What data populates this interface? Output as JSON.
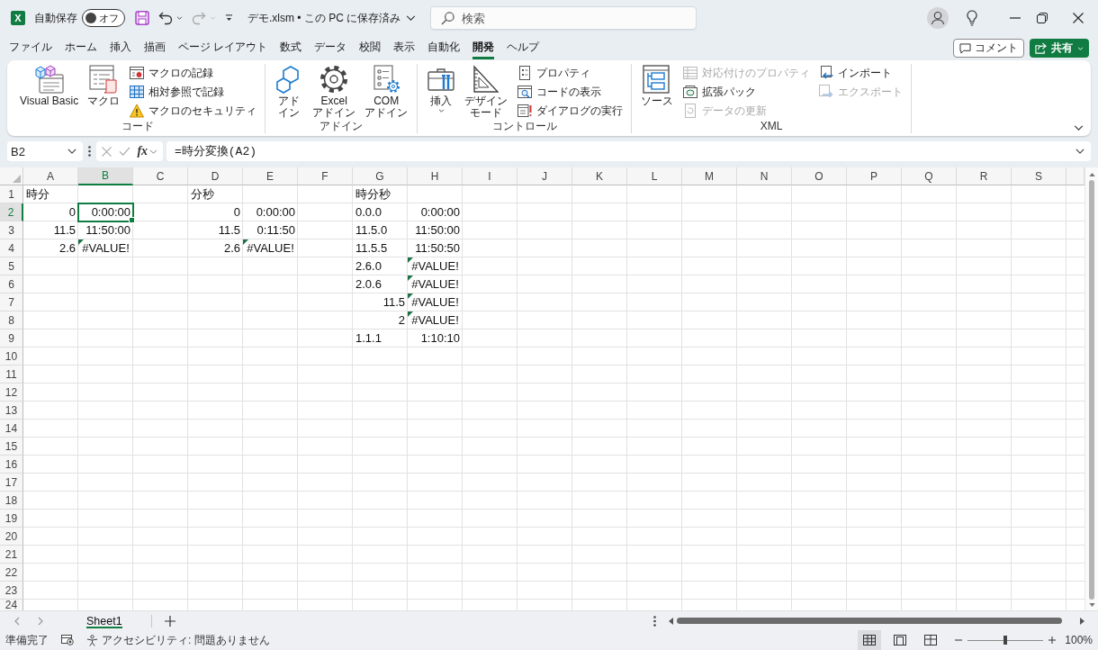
{
  "titlebar": {
    "logo": "X",
    "autosave": {
      "label": "自動保存",
      "state_text": "オフ",
      "on": false
    },
    "filename": "デモ.xlsm • この PC に保存済み",
    "search": {
      "placeholder": "検索"
    }
  },
  "tabs": [
    {
      "label": "ファイル",
      "selected": false
    },
    {
      "label": "ホーム",
      "selected": false
    },
    {
      "label": "挿入",
      "selected": false
    },
    {
      "label": "描画",
      "selected": false
    },
    {
      "label": "ページ レイアウト",
      "selected": false
    },
    {
      "label": "数式",
      "selected": false
    },
    {
      "label": "データ",
      "selected": false
    },
    {
      "label": "校閲",
      "selected": false
    },
    {
      "label": "表示",
      "selected": false
    },
    {
      "label": "自動化",
      "selected": false
    },
    {
      "label": "開発",
      "selected": true
    },
    {
      "label": "ヘルプ",
      "selected": false
    }
  ],
  "ribbon_actions": {
    "comment": "コメント",
    "share": "共有"
  },
  "ribbon": {
    "groups": [
      {
        "label": "コード",
        "large": [
          {
            "lines": [
              "Visual Basic"
            ],
            "dropdown": false
          },
          {
            "lines": [
              "マクロ"
            ],
            "dropdown": false
          }
        ],
        "small_columns": [
          [
            {
              "label": "マクロの記録",
              "disabled": false
            },
            {
              "label": "相対参照で記録",
              "disabled": false
            },
            {
              "label": "マクロのセキュリティ",
              "disabled": false
            }
          ]
        ]
      },
      {
        "label": "アドイン",
        "large": [
          {
            "lines": [
              "アド",
              "イン"
            ],
            "dropdown": false
          },
          {
            "lines": [
              "Excel",
              "アドイン"
            ],
            "dropdown": false
          },
          {
            "lines": [
              "COM",
              "アドイン"
            ],
            "dropdown": false
          }
        ]
      },
      {
        "label": "コントロール",
        "large": [
          {
            "lines": [
              "挿入"
            ],
            "dropdown": true
          },
          {
            "lines": [
              "デザイン",
              "モード"
            ],
            "dropdown": false
          }
        ],
        "small_columns": [
          [
            {
              "label": "プロパティ",
              "disabled": false
            },
            {
              "label": "コードの表示",
              "disabled": false
            },
            {
              "label": "ダイアログの実行",
              "disabled": false
            }
          ]
        ]
      },
      {
        "label": "XML",
        "large": [
          {
            "lines": [
              "ソース"
            ],
            "dropdown": false
          }
        ],
        "small_columns": [
          [
            {
              "label": "対応付けのプロパティ",
              "disabled": true
            },
            {
              "label": "拡張パック",
              "disabled": false
            },
            {
              "label": "データの更新",
              "disabled": true
            }
          ],
          [
            {
              "label": "インポート",
              "disabled": false
            },
            {
              "label": "エクスポート",
              "disabled": true
            }
          ]
        ]
      }
    ]
  },
  "formula_bar": {
    "name_box": "B2",
    "function_button": "fx",
    "formula": "=時分変換(A2)"
  },
  "sheet": {
    "columns": [
      {
        "label": "A",
        "selected": false
      },
      {
        "label": "B",
        "selected": true
      },
      {
        "label": "C",
        "selected": false
      },
      {
        "label": "D",
        "selected": false
      },
      {
        "label": "E",
        "selected": false
      },
      {
        "label": "F",
        "selected": false
      },
      {
        "label": "G",
        "selected": false
      },
      {
        "label": "H",
        "selected": false
      },
      {
        "label": "I",
        "selected": false
      },
      {
        "label": "J",
        "selected": false
      },
      {
        "label": "K",
        "selected": false
      },
      {
        "label": "L",
        "selected": false
      },
      {
        "label": "M",
        "selected": false
      },
      {
        "label": "N",
        "selected": false
      },
      {
        "label": "O",
        "selected": false
      },
      {
        "label": "P",
        "selected": false
      },
      {
        "label": "Q",
        "selected": false
      },
      {
        "label": "R",
        "selected": false
      },
      {
        "label": "S",
        "selected": false
      }
    ],
    "rows": [
      {
        "label": "1",
        "selected": false,
        "cells": {
          "A": {
            "value": "時分",
            "kind": "text",
            "selected": false
          },
          "D": {
            "value": "分秒",
            "kind": "text",
            "selected": false
          },
          "G": {
            "value": "時分秒",
            "kind": "text",
            "selected": false
          }
        }
      },
      {
        "label": "2",
        "selected": true,
        "cells": {
          "A": {
            "value": "0",
            "kind": "number",
            "selected": false
          },
          "B": {
            "value": "0:00:00",
            "kind": "number",
            "selected": true
          },
          "D": {
            "value": "0",
            "kind": "number",
            "selected": false
          },
          "E": {
            "value": "0:00:00",
            "kind": "number",
            "selected": false
          },
          "G": {
            "value": "0.0.0",
            "kind": "text",
            "selected": false
          },
          "H": {
            "value": "0:00:00",
            "kind": "number",
            "selected": false
          }
        }
      },
      {
        "label": "3",
        "selected": false,
        "cells": {
          "A": {
            "value": "11.5",
            "kind": "number",
            "selected": false
          },
          "B": {
            "value": "11:50:00",
            "kind": "number",
            "selected": false
          },
          "D": {
            "value": "11.5",
            "kind": "number",
            "selected": false
          },
          "E": {
            "value": "0:11:50",
            "kind": "number",
            "selected": false
          },
          "G": {
            "value": "11.5.0",
            "kind": "text",
            "selected": false
          },
          "H": {
            "value": "11:50:00",
            "kind": "number",
            "selected": false
          }
        }
      },
      {
        "label": "4",
        "selected": false,
        "cells": {
          "A": {
            "value": "2.6",
            "kind": "number",
            "selected": false
          },
          "B": {
            "value": "#VALUE!",
            "kind": "error",
            "selected": false
          },
          "D": {
            "value": "2.6",
            "kind": "number",
            "selected": false
          },
          "E": {
            "value": "#VALUE!",
            "kind": "error",
            "selected": false
          },
          "G": {
            "value": "11.5.5",
            "kind": "text",
            "selected": false
          },
          "H": {
            "value": "11:50:50",
            "kind": "number",
            "selected": false
          }
        }
      },
      {
        "label": "5",
        "selected": false,
        "cells": {
          "G": {
            "value": "2.6.0",
            "kind": "text",
            "selected": false
          },
          "H": {
            "value": "#VALUE!",
            "kind": "error",
            "selected": false
          }
        }
      },
      {
        "label": "6",
        "selected": false,
        "cells": {
          "G": {
            "value": "2.0.6",
            "kind": "text",
            "selected": false
          },
          "H": {
            "value": "#VALUE!",
            "kind": "error",
            "selected": false
          }
        }
      },
      {
        "label": "7",
        "selected": false,
        "cells": {
          "G": {
            "value": "11.5",
            "kind": "number",
            "selected": false
          },
          "H": {
            "value": "#VALUE!",
            "kind": "error",
            "selected": false
          }
        }
      },
      {
        "label": "8",
        "selected": false,
        "cells": {
          "G": {
            "value": "2",
            "kind": "number",
            "selected": false
          },
          "H": {
            "value": "#VALUE!",
            "kind": "error",
            "selected": false
          }
        }
      },
      {
        "label": "9",
        "selected": false,
        "cells": {
          "G": {
            "value": "1.1.1",
            "kind": "text",
            "selected": false
          },
          "H": {
            "value": "1:10:10",
            "kind": "number",
            "selected": false
          }
        }
      },
      {
        "label": "10",
        "selected": false
      },
      {
        "label": "11",
        "selected": false
      },
      {
        "label": "12",
        "selected": false
      },
      {
        "label": "13",
        "selected": false
      },
      {
        "label": "14",
        "selected": false
      },
      {
        "label": "15",
        "selected": false
      },
      {
        "label": "16",
        "selected": false
      },
      {
        "label": "17",
        "selected": false
      },
      {
        "label": "18",
        "selected": false
      },
      {
        "label": "19",
        "selected": false
      },
      {
        "label": "20",
        "selected": false
      },
      {
        "label": "21",
        "selected": false
      },
      {
        "label": "22",
        "selected": false
      },
      {
        "label": "23",
        "selected": false
      },
      {
        "label": "24",
        "selected": false
      }
    ]
  },
  "sheet_tabs": [
    {
      "label": "Sheet1",
      "selected": true
    }
  ],
  "status_bar": {
    "mode": "準備完了",
    "accessibility": "アクセシビリティ: 問題ありません",
    "views": [
      {
        "selected": true
      },
      {
        "selected": false
      },
      {
        "selected": false
      }
    ],
    "zoom": {
      "level": 0.5,
      "reading": "100%"
    }
  }
}
